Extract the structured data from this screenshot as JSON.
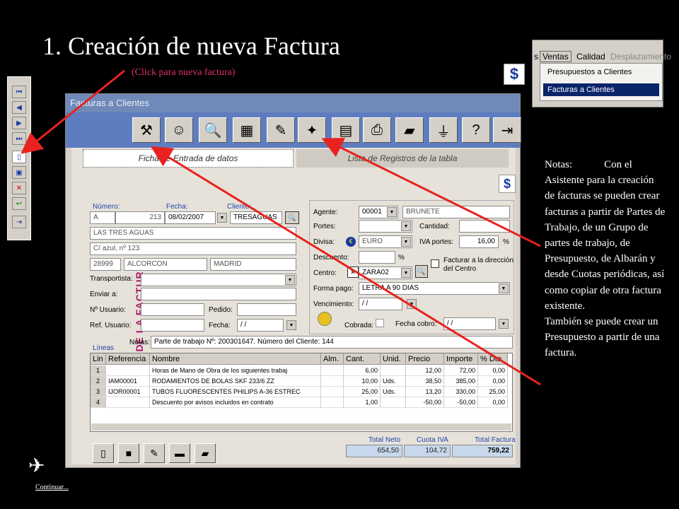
{
  "slide": {
    "title": "1. Creación de nueva Factura",
    "subtitle": "(Click para nueva factura)",
    "continue_label": "Continuar...",
    "notes_label": "Notas:",
    "notes_text": "Con el Asistente para la creación de facturas se pueden crear facturas a partir de Partes de Trabajo, de un Grupo de partes de trabajo, de Presupuesto, de Albarán y desde Cuotas periódicas, así como copiar de otra factura existente.",
    "notes_text2": "También se puede crear un Presupuesto a partir de una factura.",
    "arrow_color": "#e8221e"
  },
  "menu": {
    "items": [
      "s",
      "Ventas",
      "Calidad",
      "Desplazamiento"
    ],
    "dropdown": [
      "Presupuestos a Clientes",
      "Facturas a Clientes"
    ]
  },
  "window": {
    "title": "Facturas a Clientes",
    "tab_active": "Ficha de Entrada de datos",
    "tab_inactive": "Lista de Registros de la tabla",
    "vertical_label": "FICHA DE LA FACTURA",
    "toolbar_icons": [
      "wizard-icon",
      "person-icon",
      "search-icon",
      "report-icon",
      "edit-icon",
      "magic-icon",
      "document-icon",
      "print-icon",
      "book-icon",
      "filter-icon",
      "help-icon",
      "exit-icon"
    ],
    "toolbar_glyphs": [
      "⚒",
      "☺",
      "🔍",
      "▦",
      "✎",
      "✦",
      "▤",
      "⎙",
      "▰",
      "⏚",
      "?",
      "⇥"
    ]
  },
  "form": {
    "numero_label": "Número:",
    "fecha_label": "Fecha:",
    "cliente_label": "Cliente:",
    "serie": "A",
    "numero": "213",
    "fecha": "08/02/2007",
    "cliente": "TRESAGUAS",
    "nombre": "LAS TRES AGUAS",
    "direccion": "C/ azul, nº 123",
    "cp": "28999",
    "poblacion": "ALCORCON",
    "provincia": "MADRID",
    "transportista_label": "Transportista:",
    "enviar_label": "Enviar a:",
    "nusuario_label": "Nº Usuario:",
    "pedido_label": "Pedido:",
    "refusuario_label": "Ref. Usuario:",
    "fecha2_label": "Fecha:",
    "fecha2": " / /",
    "agente_label": "Agente:",
    "agente": "00001",
    "agente_nombre": "BRUNETE",
    "portes_label": "Portes:",
    "cantidad_label": "Cantidad:",
    "divisa_label": "Divisa:",
    "divisa": "EURO",
    "iva_portes_label": "IVA portes:",
    "iva_portes": "16,00",
    "pct": "%",
    "descuento_label": "Descuento:",
    "pct2": "%",
    "centro_label": "Centro:",
    "centro": "ZARA02",
    "facturar_label": "Facturar a la dirección del Centro",
    "forma_pago_label": "Forma pago:",
    "forma_pago": "LETRA A 90 DIAS",
    "vencimiento_label": "Vencimiento:",
    "vencimiento": " / /",
    "cobrada_label": "Cobrada:",
    "fecha_cobro_label": "Fecha cobro:",
    "fecha_cobro": " / /",
    "notas_label": "Notas:",
    "notas": "Parte de trabajo Nº: 200301647. Número del Cliente: 144",
    "lineas_label": "Líneas"
  },
  "grid": {
    "headers": [
      "Lin",
      "Referencia",
      "Nombre",
      "Alm.",
      "Cant.",
      "Unid.",
      "Precio",
      "Importe",
      "% Dto"
    ],
    "rows": [
      [
        "1",
        "",
        "Horas de Mano de Obra de los siguientes trabaj",
        "",
        "6,00",
        "",
        "12,00",
        "72,00",
        "0,00"
      ],
      [
        "2",
        "IAM00001",
        "RODAMIENTOS DE BOLAS SKF 233/6 ZZ",
        "",
        "10,00",
        "Uds.",
        "38,50",
        "385,00",
        "0,00"
      ],
      [
        "3",
        "IJOR00001",
        "TUBOS FLUORESCENTES PHILIPS A-36 ESTREC",
        "",
        "25,00",
        "Uds.",
        "13,20",
        "330,00",
        "25,00"
      ],
      [
        "4",
        "",
        "Descuento por avisos incluidos en contrato",
        "",
        "1,00",
        "",
        "-50,00",
        "-50,00",
        "0,00"
      ]
    ]
  },
  "totals": {
    "neto_label": "Total Neto",
    "iva_label": "Cuota IVA",
    "total_label": "Total Factura",
    "neto": "654,50",
    "iva": "104,72",
    "total": "759,22"
  }
}
